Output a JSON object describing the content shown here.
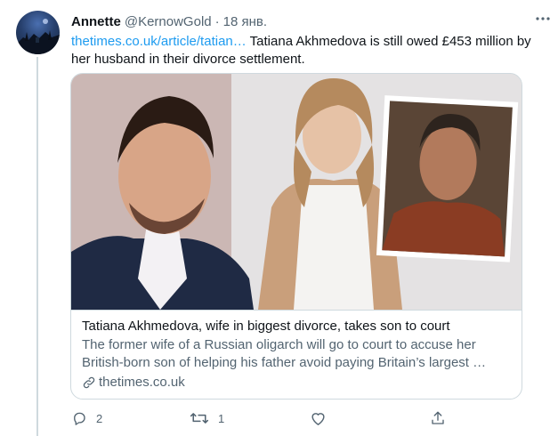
{
  "tweet": {
    "author_name": "Annette",
    "handle": "@KernowGold",
    "separator": "·",
    "date": "18 янв.",
    "text_link": "thetimes.co.uk/article/tatian…",
    "text_body": " Tatiana Akhmedova is still owed £453 million by her husband in their divorce settlement."
  },
  "card": {
    "title": "Tatiana Akhmedova, wife in biggest divorce, takes son to court",
    "description": "The former wife of a Russian oligarch will go to court to accuse her British-born son of helping his father avoid paying Britain’s largest …",
    "domain": "thetimes.co.uk"
  },
  "actions": {
    "reply_count": "2",
    "retweet_count": "1",
    "like_count": "",
    "share_count": ""
  },
  "colors": {
    "link": "#1d9bf0",
    "secondary_text": "#536471",
    "border": "#cfd9de",
    "primary_text": "#0f1419"
  },
  "icons": {
    "more": "more-dots-icon",
    "reply": "reply-icon",
    "retweet": "retweet-icon",
    "like": "like-icon",
    "share": "share-icon",
    "link": "link-icon"
  }
}
